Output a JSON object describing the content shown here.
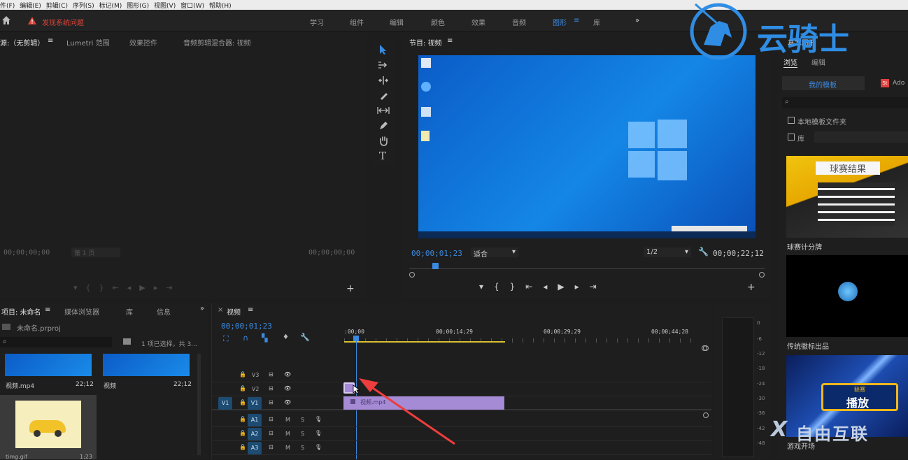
{
  "menu": [
    "件(F)",
    "编辑(E)",
    "剪辑(C)",
    "序列(S)",
    "标记(M)",
    "图形(G)",
    "视图(V)",
    "窗口(W)",
    "帮助(H)"
  ],
  "alert": {
    "label": "发现系统问题"
  },
  "workspaces": [
    "学习",
    "组件",
    "编辑",
    "颜色",
    "效果",
    "音频",
    "图形",
    "库"
  ],
  "workspaces_more": "»",
  "watermark": {
    "brand_text": "云骑士"
  },
  "watermark_bottom": {
    "brand_text": "自由互联"
  },
  "source_panel": {
    "tabs": [
      "源:（无剪辑）",
      "Lumetri 范围",
      "效果控件",
      "音频剪辑混合器: 视频"
    ],
    "menu_icon": "≡",
    "timecode_left": "00;00;00;00",
    "page_select": "第 1 页",
    "timecode_right": "00;00;00;00"
  },
  "tools": [
    "selection-tool",
    "track-select-tool",
    "ripple-edit-tool",
    "razor-tool",
    "slip-tool",
    "pen-tool",
    "hand-tool",
    "type-tool"
  ],
  "program_panel": {
    "title": "节目: 视频",
    "timecode": "00;00;01;23",
    "fit": "适合",
    "resolution": "1/2",
    "duration": "00;00;22;12"
  },
  "project_panel": {
    "tabs": [
      "项目: 未命名",
      "媒体浏览器",
      "库",
      "信息"
    ],
    "project_file": "未命名.prproj",
    "selection_info": "1 项已选择，共 3...",
    "items": [
      {
        "name": "视频.mp4",
        "duration": "22;12"
      },
      {
        "name": "视频",
        "duration": "22;12"
      },
      {
        "name": "timg.gif",
        "duration": "1;23"
      }
    ]
  },
  "timeline": {
    "close": "×",
    "title": "视频",
    "menu_icon": "≡",
    "timecode": "00;00;01;23",
    "ruler_labels": [
      ":00;00",
      "00;00;14;29",
      "00;00;29;29",
      "00;00;44;28"
    ],
    "tracks": [
      {
        "id": "V3",
        "label": "V3"
      },
      {
        "id": "V2",
        "label": "V2"
      },
      {
        "id": "V1",
        "label": "V1",
        "source": "V1"
      },
      {
        "id": "A1",
        "label": "A1",
        "m": "M",
        "s": "S"
      },
      {
        "id": "A2",
        "label": "A2",
        "m": "M",
        "s": "S"
      },
      {
        "id": "A3",
        "label": "A3",
        "m": "M",
        "s": "S"
      }
    ],
    "clip": {
      "name": "视频.mp4"
    }
  },
  "meter": {
    "ticks": [
      "0",
      "-6",
      "-12",
      "-18",
      "-24",
      "-30",
      "-36",
      "-42",
      "-48"
    ]
  },
  "graphics_panel": {
    "title": "基本图形",
    "tabs": [
      "浏览",
      "编辑"
    ],
    "subtabs": [
      "我的模板",
      "Ado"
    ],
    "stock_badge": "St",
    "checkbox_local": "本地模板文件夹",
    "checkbox_lib": "库",
    "templates": [
      {
        "name": "球赛计分牌",
        "thumb_title": "球赛结果"
      },
      {
        "name": "传统徽标出品"
      },
      {
        "name": "游戏开场",
        "thumb_badge": "联赛",
        "thumb_text": "播放"
      }
    ]
  },
  "colors": {
    "accent": "#3b8ae0",
    "clip": "#a58ad6",
    "desktop": "#0f6fd3",
    "alert": "#e0443a",
    "arrow": "#ee3d3d"
  }
}
